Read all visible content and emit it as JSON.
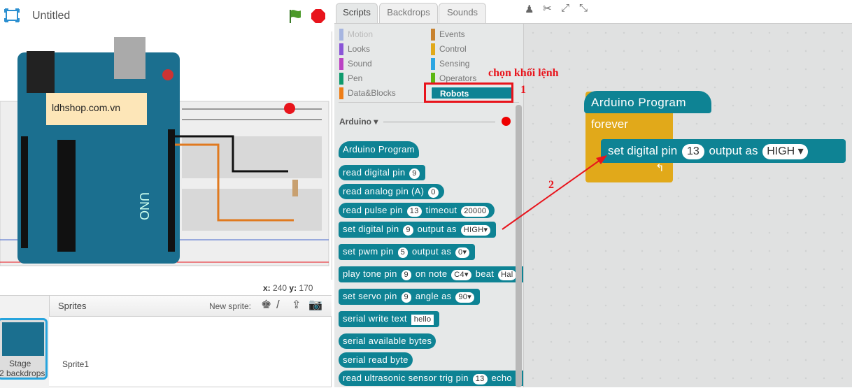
{
  "stage": {
    "title": "Untitled",
    "label_shop": "ldhshop.com.vn",
    "coords": {
      "x_label": "x:",
      "x": "240",
      "y_label": "y:",
      "y": "170"
    }
  },
  "sprites": {
    "header": "Sprites",
    "new_sprite": "New sprite:",
    "stage_label": "Stage",
    "backdrops": "2 backdrops",
    "sprite1": "Sprite1"
  },
  "tabs": [
    "Scripts",
    "Backdrops",
    "Sounds"
  ],
  "categories": [
    {
      "label": "Motion",
      "color": "#a6b5e0"
    },
    {
      "label": "Looks",
      "color": "#8a55d7"
    },
    {
      "label": "Sound",
      "color": "#bb42c3"
    },
    {
      "label": "Pen",
      "color": "#0e9a6c"
    },
    {
      "label": "Data&Blocks",
      "color": "#ee7d16"
    },
    {
      "label": "Events",
      "color": "#c88330"
    },
    {
      "label": "Control",
      "color": "#e1a91a"
    },
    {
      "label": "Sensing",
      "color": "#2ca5e2"
    },
    {
      "label": "Operators",
      "color": "#5cb712"
    },
    {
      "label": "Robots",
      "color": "#0e8394"
    }
  ],
  "palette": {
    "section": "Arduino ▾",
    "blocks": {
      "program": "Arduino Program",
      "read_digital": "read digital pin",
      "read_analog": "read analog pin (A)",
      "read_pulse": "read pulse pin",
      "timeout": "timeout",
      "set_digital": "set digital pin",
      "output_as": "output as",
      "set_pwm": "set pwm pin",
      "play_tone": "play tone pin",
      "on_note": "on note",
      "beat": "beat",
      "set_servo": "set servo pin",
      "angle_as": "angle as",
      "serial_write": "serial write text",
      "serial_avail": "serial available bytes",
      "serial_read": "serial read byte",
      "ultrasonic": "read ultrasonic sensor trig pin",
      "echo": "echo"
    },
    "values": {
      "rd": "9",
      "ra": "0",
      "rp": "13",
      "to": "20000",
      "sd": "9",
      "high": "HIGH▾",
      "pwm": "5",
      "pwmv": "0▾",
      "tone": "9",
      "note": "C4▾",
      "beat": "Hal",
      "servo": "9",
      "angle": "90▾",
      "hello": "hello",
      "trig": "13"
    }
  },
  "script": {
    "program": "Arduino Program",
    "forever": "forever",
    "set_digital": "set digital pin",
    "pin": "13",
    "output_as": "output as",
    "value": "HIGH ▾"
  },
  "annotations": {
    "choose": "chọn khối lệnh",
    "n1": "1",
    "n2": "2",
    "accent": "#e8141c"
  }
}
